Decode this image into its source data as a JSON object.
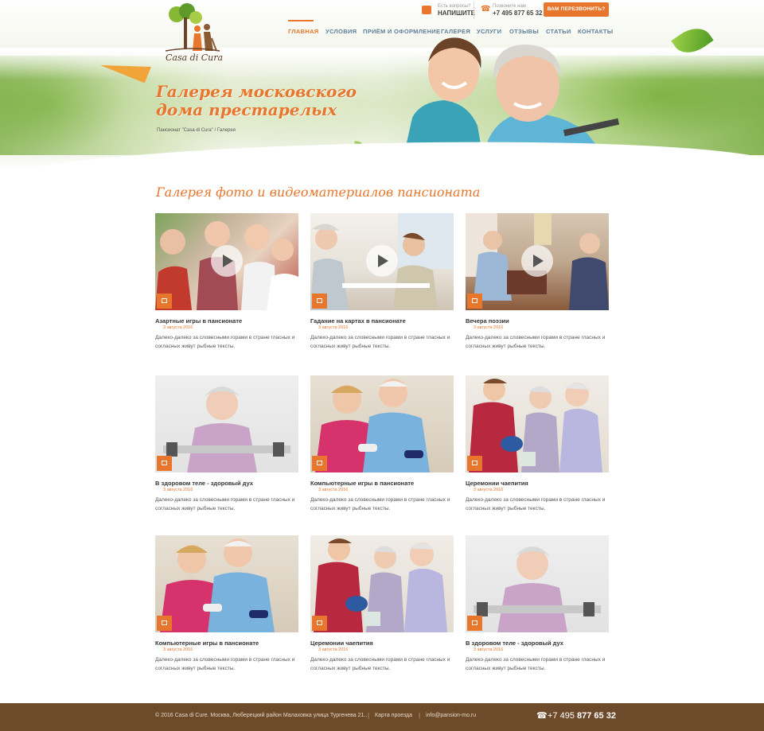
{
  "brand": {
    "name": "Casa di Cura"
  },
  "header": {
    "question_small": "Есть вопросы?",
    "question_big": "НАПИШИТЕ",
    "call_small": "Позвоните нам",
    "call_big": "+7 495 877 65 32",
    "callback_button": "ВАМ ПЕРЕЗВОНИТЬ?"
  },
  "nav": {
    "items": [
      "ГЛАВНАЯ",
      "УСЛОВИЯ",
      "ПРИЁМ И ОФОРМЛЕНИЕ",
      "ГАЛЕРЕЯ",
      "УСЛУГИ",
      "ОТЗЫВЫ",
      "СТАТЬИ",
      "КОНТАКТЫ"
    ],
    "active": "ГЛАВНАЯ"
  },
  "hero": {
    "title": "Галерея московского дома престарелых",
    "breadcrumb": [
      "Пансионат \"Casa di Cura\"",
      "Галерея"
    ]
  },
  "gallery": {
    "title": "Галерея фото и видеоматериалов пансионата",
    "items": [
      {
        "title": "Азартные игры в пансионате",
        "date": "3 августа 2016",
        "desc": "Далеко-далеко за словесными горами в стране гласных и согласных живут рыбные тексты.",
        "media": "video"
      },
      {
        "title": "Гадание на картах в пансионате",
        "date": "3 августа 2016",
        "desc": "Далеко-далеко за словесными горами в стране гласных и согласных живут рыбные тексты.",
        "media": "video"
      },
      {
        "title": "Вечера поэзии",
        "date": "3 августа 2016",
        "desc": "Далеко-далеко за словесными горами в стране гласных и согласных живут рыбные тексты.",
        "media": "video"
      },
      {
        "title": "В здоровом теле - здоровый дух",
        "date": "3 августа 2016",
        "desc": "Далеко-далеко за словесными горами в стране гласных и согласных живут рыбные тексты.",
        "media": "photo"
      },
      {
        "title": "Компьютерные игры в пансионате",
        "date": "3 августа 2016",
        "desc": "Далеко-далеко за словесными горами в стране гласных и согласных живут рыбные тексты.",
        "media": "photo"
      },
      {
        "title": "Церемонии чаепития",
        "date": "3 августа 2016",
        "desc": "Далеко-далеко за словесными горами в стране гласных и согласных живут рыбные тексты.",
        "media": "photo"
      },
      {
        "title": "Компьютерные игры в пансионате",
        "date": "3 августа 2016",
        "desc": "Далеко-далеко за словесными горами в стране гласных и согласных живут рыбные тексты.",
        "media": "photo"
      },
      {
        "title": "Церемонии чаепития",
        "date": "3 августа 2016",
        "desc": "Далеко-далеко за словесными горами в стране гласных и согласных живут рыбные тексты.",
        "media": "photo"
      },
      {
        "title": "В здоровом теле - здоровый дух",
        "date": "3 августа 2016",
        "desc": "Далеко-далеко за словесными горами в стране гласных и согласных живут рыбные тексты.",
        "media": "photo"
      }
    ]
  },
  "footer": {
    "copyright": "© 2016 Casa di Cure. Москва, Люберецкий район Малаховка улица Тургенева 21..",
    "map_link": "Карта проезда",
    "email": "info@pansion-mo.ru",
    "phone_prefix": "+7 495",
    "phone_number": "877 65 32"
  },
  "colors": {
    "accent": "#e8762c",
    "nav": "#5e7f9a",
    "footer": "#6d4a2a"
  }
}
